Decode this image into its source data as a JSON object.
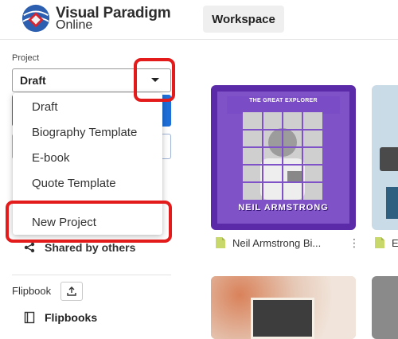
{
  "header": {
    "brand_line1": "Visual Paradigm",
    "brand_line2": "Online",
    "workspace_label": "Workspace"
  },
  "sidebar": {
    "project_label": "Project",
    "project_selected": "Draft",
    "shared_label": "Shared by others",
    "flipbook_label": "Flipbook",
    "flipbooks_label": "Flipbooks"
  },
  "menu": {
    "items": [
      "Draft",
      "Biography Template",
      "E-book",
      "Quote Template"
    ],
    "new_project": "New Project"
  },
  "cards": [
    {
      "title_banner": "THE GREAT EXPLORER",
      "name_banner": "NEIL ARMSTRONG",
      "caption": "Neil Armstrong Bi...",
      "more": "⋮"
    },
    {
      "caption": "E"
    }
  ],
  "colors": {
    "accent_blue": "#1e6fd9",
    "annotation_red": "#e31b1b",
    "card_purple": "#5b2aa8"
  },
  "icons": {
    "logo": "visual-paradigm-logo",
    "caret": "chevron-down-icon",
    "shared": "share-icon",
    "upload": "upload-icon",
    "flipbooks": "book-icon",
    "doc": "document-icon",
    "more": "more-vertical-icon"
  }
}
